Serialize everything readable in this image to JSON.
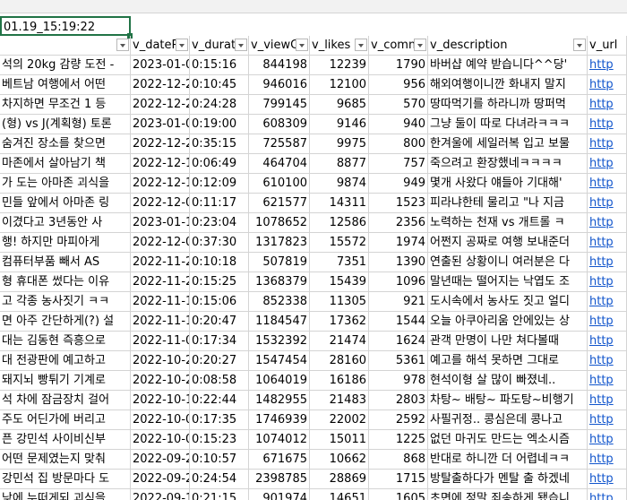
{
  "selected_cell": "01.19_15:19:22",
  "columns": {
    "title": "",
    "date": "v_dateP",
    "duration": "v_durati",
    "views": "v_viewC",
    "likes": "v_likes",
    "comments": "v_comm",
    "description": "v_description",
    "url": "v_url"
  },
  "rows": [
    {
      "title": "석의 20kg 감량 도전 -",
      "date": "2023-01-0",
      "duration": "0:15:16",
      "views": "844198",
      "likes": "12239",
      "comments": "1790",
      "description": "바버샵 예약 받습니다^^당'",
      "url": "http"
    },
    {
      "title": "베트남 여행에서 어떤",
      "date": "2022-12-2",
      "duration": "0:10:45",
      "views": "946016",
      "likes": "12100",
      "comments": "956",
      "description": "해외여행이니깐 화내지 말지",
      "url": "http"
    },
    {
      "title": "차지하면 무조건 1 등",
      "date": "2022-12-2",
      "duration": "0:24:28",
      "views": "799145",
      "likes": "9685",
      "comments": "570",
      "description": "땅따먹기를 하라니까 땅퍼먹",
      "url": "http"
    },
    {
      "title": "(형) vs J(계획형) 토론",
      "date": "2023-01-0",
      "duration": "0:19:00",
      "views": "608309",
      "likes": "9146",
      "comments": "940",
      "description": "그냥 둘이 따로 다녀라ㅋㅋㅋ",
      "url": "http"
    },
    {
      "title": "숨겨진 장소를 찾으면",
      "date": "2022-12-2",
      "duration": "0:35:15",
      "views": "725587",
      "likes": "9975",
      "comments": "800",
      "description": "한겨울에 세일러복 입고 보물",
      "url": "http"
    },
    {
      "title": "마존에서 살아남기 책",
      "date": "2022-12-1",
      "duration": "0:06:49",
      "views": "464704",
      "likes": "8877",
      "comments": "757",
      "description": "죽으려고 환장했네ㅋㅋㅋㅋ",
      "url": "http"
    },
    {
      "title": "가 도는 아마존 괴식을",
      "date": "2022-12-1",
      "duration": "0:12:09",
      "views": "610100",
      "likes": "9874",
      "comments": "949",
      "description": "몇개 사왔다 얘들아 기대해'",
      "url": "http"
    },
    {
      "title": "민들 앞에서 아마존 링",
      "date": "2022-12-0",
      "duration": "0:11:17",
      "views": "621577",
      "likes": "14311",
      "comments": "1523",
      "description": "피라냐한테 물리고 \"나 지금",
      "url": "http"
    },
    {
      "title": "이겼다고 3년동안 사",
      "date": "2023-01-1",
      "duration": "0:23:04",
      "views": "1078652",
      "likes": "12586",
      "comments": "2356",
      "description": "노력하는 천재 vs 개트롤 ㅋ",
      "url": "http"
    },
    {
      "title": "행! 하지만 마피아게",
      "date": "2022-12-0",
      "duration": "0:37:30",
      "views": "1317823",
      "likes": "15572",
      "comments": "1974",
      "description": "어쩐지 공짜로 여행 보내준더",
      "url": "http"
    },
    {
      "title": "컴퓨터부품 빼서 AS",
      "date": "2022-11-2",
      "duration": "0:10:18",
      "views": "507819",
      "likes": "7351",
      "comments": "1390",
      "description": "연출된 상황이니 여러분은 다",
      "url": "http"
    },
    {
      "title": "형 휴대폰 썼다는 이유",
      "date": "2022-11-2",
      "duration": "0:15:25",
      "views": "1368379",
      "likes": "15439",
      "comments": "1096",
      "description": "말년때는 떨어지는 낙엽도 조",
      "url": "http"
    },
    {
      "title": "고 각종 농사짓기 ㅋㅋ",
      "date": "2022-11-1",
      "duration": "0:15:06",
      "views": "852338",
      "likes": "11305",
      "comments": "921",
      "description": "도시속에서 농사도 짓고 얼디",
      "url": "http"
    },
    {
      "title": "면 아주 간단하게(?) 설",
      "date": "2022-11-1",
      "duration": "0:20:47",
      "views": "1184547",
      "likes": "17362",
      "comments": "1544",
      "description": "오늘 아쿠아리움 안에있는 상",
      "url": "http"
    },
    {
      "title": "대는 김동현 즉흥으로",
      "date": "2022-11-0",
      "duration": "0:17:34",
      "views": "1532392",
      "likes": "21474",
      "comments": "1624",
      "description": "관객 만명이 나만 쳐다볼때",
      "url": "http"
    },
    {
      "title": "대 전광판에 예고하고",
      "date": "2022-10-2",
      "duration": "0:20:27",
      "views": "1547454",
      "likes": "28160",
      "comments": "5361",
      "description": "예고를 해석 못하면 그대로",
      "url": "http"
    },
    {
      "title": "돼지뇌 빵튀기 기계로",
      "date": "2022-10-2",
      "duration": "0:08:58",
      "views": "1064019",
      "likes": "16186",
      "comments": "978",
      "description": "현석이형 살 많이 빠졌네..",
      "url": "http"
    },
    {
      "title": "석 차에 잠금장치 걸어",
      "date": "2022-10-1",
      "duration": "0:22:44",
      "views": "1482955",
      "likes": "21483",
      "comments": "2803",
      "description": "차탕~ 배탕~ 파도탕~비행기",
      "url": "http"
    },
    {
      "title": "주도 어딘가에 버리고",
      "date": "2022-10-0",
      "duration": "0:17:35",
      "views": "1746939",
      "likes": "22002",
      "comments": "2592",
      "description": "사필귀정.. 콩심은데 콩나고",
      "url": "http"
    },
    {
      "title": "픈 강민석 사이비신부",
      "date": "2022-10-0",
      "duration": "0:15:23",
      "views": "1074012",
      "likes": "15011",
      "comments": "1225",
      "description": "없던 마귀도 만드는 엑소시즘",
      "url": "http"
    },
    {
      "title": "어떤 문제였는지 맞춰",
      "date": "2022-09-2",
      "duration": "0:10:57",
      "views": "671675",
      "likes": "10662",
      "comments": "868",
      "description": "반대로 하니깐 더 어렵네ㅋㅋ",
      "url": "http"
    },
    {
      "title": "강민석 집 방문마다 도",
      "date": "2022-09-2",
      "duration": "0:24:54",
      "views": "2398785",
      "likes": "28869",
      "comments": "1715",
      "description": "방탈출하다가 멘탈 출 하겠네",
      "url": "http"
    },
    {
      "title": "낮에 누떠게되 괴식을",
      "date": "2022-09-1",
      "duration": "0:21:15",
      "views": "901974",
      "likes": "14651",
      "comments": "1605",
      "description": "초면에 정말 죄송하게 됐습니",
      "url": "http"
    }
  ]
}
